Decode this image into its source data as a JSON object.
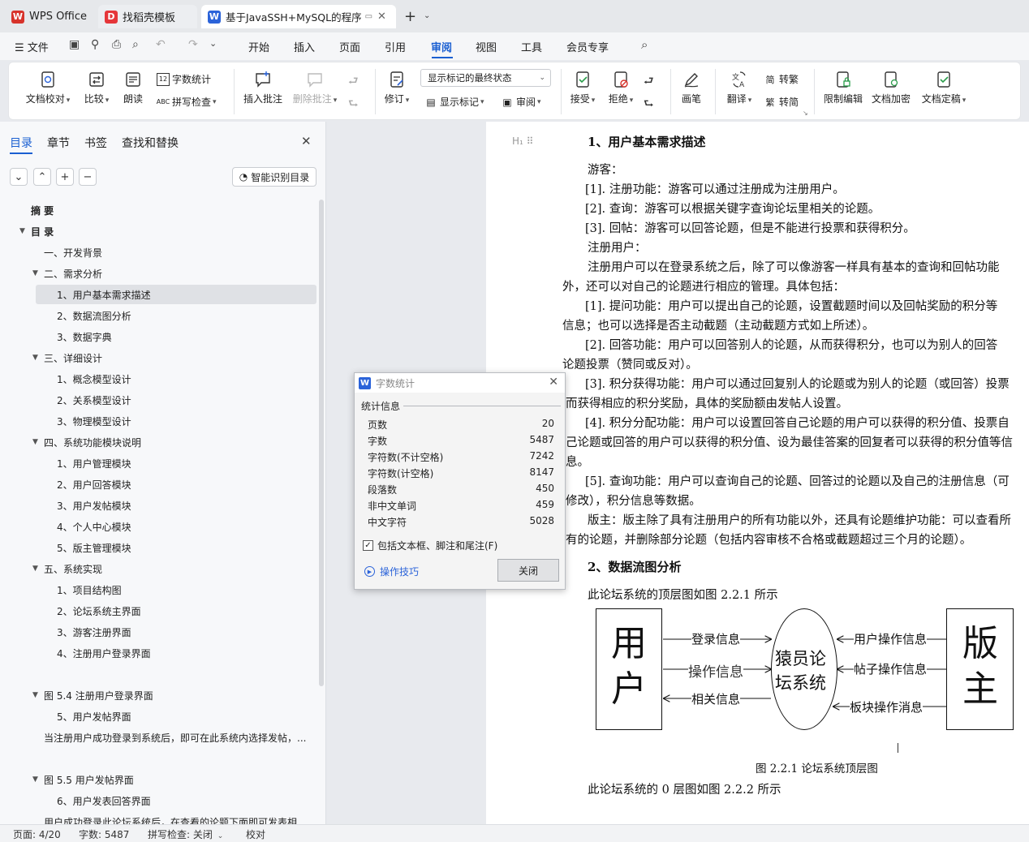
{
  "tabs": [
    {
      "label": "WPS Office",
      "logo": "W",
      "color": "#d7332b"
    },
    {
      "label": "找稻壳模板",
      "logo": "D",
      "color": "#e5363a"
    },
    {
      "label": "基于JavaSSH+MySQL的程序",
      "logo": "W",
      "color": "#2b63d9"
    }
  ],
  "menu": {
    "file": "文件",
    "items": [
      "开始",
      "插入",
      "页面",
      "引用",
      "审阅",
      "视图",
      "工具",
      "会员专享"
    ],
    "active": "审阅"
  },
  "ribbon": {
    "doc_check": "文档校对",
    "compare": "比较",
    "read_aloud": "朗读",
    "word_count": "字数统计",
    "spell_check": "拼写检查",
    "insert_comment": "插入批注",
    "delete_comment": "删除批注",
    "revise": "修订",
    "markup_state": "显示标记的最终状态",
    "show_markup": "显示标记",
    "review_pane": "审阅",
    "accept": "接受",
    "reject": "拒绝",
    "pen": "画笔",
    "translate": "翻译",
    "to_traditional": "转繁",
    "to_simplified": "转简",
    "restrict_edit": "限制编辑",
    "encrypt": "文档加密",
    "finalize": "文档定稿"
  },
  "left_panel": {
    "tabs": [
      "目录",
      "章节",
      "书签",
      "查找和替换"
    ],
    "smart_btn": "智能识别目录",
    "toc": [
      {
        "label": "摘  要",
        "level": 0,
        "arrow": false
      },
      {
        "label": "目  录",
        "level": 0,
        "arrow": true
      },
      {
        "label": "一、开发背景",
        "level": 1,
        "arrow": false
      },
      {
        "label": "二、需求分析",
        "level": 1,
        "arrow": true
      },
      {
        "label": "1、用户基本需求描述",
        "level": 2,
        "arrow": false,
        "selected": true
      },
      {
        "label": "2、数据流图分析",
        "level": 2,
        "arrow": false
      },
      {
        "label": "3、数据字典",
        "level": 2,
        "arrow": false
      },
      {
        "label": "三、详细设计",
        "level": 1,
        "arrow": true
      },
      {
        "label": "1、概念模型设计",
        "level": 2,
        "arrow": false
      },
      {
        "label": "2、关系模型设计",
        "level": 2,
        "arrow": false
      },
      {
        "label": "3、物理模型设计",
        "level": 2,
        "arrow": false
      },
      {
        "label": "四、系统功能模块说明",
        "level": 1,
        "arrow": true
      },
      {
        "label": "1、用户管理模块",
        "level": 2,
        "arrow": false
      },
      {
        "label": "2、用户回答模块",
        "level": 2,
        "arrow": false
      },
      {
        "label": "3、用户发帖模块",
        "level": 2,
        "arrow": false
      },
      {
        "label": "4、个人中心模块",
        "level": 2,
        "arrow": false
      },
      {
        "label": "5、版主管理模块",
        "level": 2,
        "arrow": false
      },
      {
        "label": "五、系统实现",
        "level": 1,
        "arrow": true
      },
      {
        "label": "1、项目结构图",
        "level": 2,
        "arrow": false
      },
      {
        "label": "2、论坛系统主界面",
        "level": 2,
        "arrow": false
      },
      {
        "label": "3、游客注册界面",
        "level": 2,
        "arrow": false
      },
      {
        "label": "4、注册用户登录界面",
        "level": 2,
        "arrow": false
      },
      {
        "label": "",
        "level": 2,
        "arrow": false
      },
      {
        "label": "图 5.4  注册用户登录界面",
        "level": 1,
        "arrow": true
      },
      {
        "label": "5、用户发帖界面",
        "level": 2,
        "arrow": false
      },
      {
        "label": "当注册用户成功登录到系统后，即可在此系统内选择发帖，...",
        "level": 1,
        "arrow": false
      },
      {
        "label": "",
        "level": 2,
        "arrow": false
      },
      {
        "label": "图 5.5  用户发帖界面",
        "level": 1,
        "arrow": true
      },
      {
        "label": "6、用户发表回答界面",
        "level": 2,
        "arrow": false
      },
      {
        "label": "用户成功登录此论坛系统后，在查看的论题下面即可发表相...",
        "level": 1,
        "arrow": false
      }
    ]
  },
  "dialog": {
    "title": "字数统计",
    "section": "统计信息",
    "stats": [
      {
        "label": "页数",
        "value": "20"
      },
      {
        "label": "字数",
        "value": "5487"
      },
      {
        "label": "字符数(不计空格)",
        "value": "7242"
      },
      {
        "label": "字符数(计空格)",
        "value": "8147"
      },
      {
        "label": "段落数",
        "value": "450"
      },
      {
        "label": "非中文单词",
        "value": "459"
      },
      {
        "label": "中文字符",
        "value": "5028"
      }
    ],
    "checkbox_label": "包括文本框、脚注和尾注(F)",
    "tips": "操作技巧",
    "close_btn": "关闭"
  },
  "document": {
    "heading1": "1、用户基本需求描述",
    "lines": [
      "游客：",
      "[1]. 注册功能：游客可以通过注册成为注册用户。",
      "[2]. 查询：游客可以根据关键字查询论坛里相关的论题。",
      "[3]. 回帖：游客可以回答论题，但是不能进行投票和获得积分。",
      "注册用户：",
      "注册用户可以在登录系统之后，除了可以像游客一样具有基本的查询和回帖功能",
      "外，还可以对自己的论题进行相应的管理。具体包括：",
      "[1]. 提问功能：用户可以提出自己的论题，设置截题时间以及回帖奖励的积分等",
      "信息；也可以选择是否主动截题（主动截题方式如上所述）。",
      "[2]. 回答功能：用户可以回答别人的论题，从而获得积分，也可以为别人的回答",
      "论题投票（赞同或反对）。",
      "[3]. 积分获得功能：用户可以通过回复别人的论题或为别人的论题（或回答）投票",
      "而获得相应的积分奖励，具体的奖励额由发帖人设置。",
      "[4]. 积分分配功能：用户可以设置回答自己论题的用户可以获得的积分值、投票自",
      "己论题或回答的用户可以获得的积分值、设为最佳答案的回复者可以获得的积分值等信",
      "息。",
      "[5]. 查询功能：用户可以查询自己的论题、回答过的论题以及自己的注册信息（可",
      "修改），积分信息等数据。",
      "版主：版主除了具有注册用户的所有功能以外，还具有论题维护功能：可以查看所",
      "有的论题，并删除部分论题（包括内容审核不合格或截题超过三个月的论题）。"
    ],
    "heading2": "2、数据流图分析",
    "para_top": "此论坛系统的顶层图如图 2.2.1 所示",
    "caption": "图 2.2.1 论坛系统顶层图",
    "para_zero": "此论坛系统的 0 层图如图 2.2.2 所示",
    "diagram": {
      "left_box": "用户",
      "right_box": "版主",
      "center": [
        "猿员论",
        "坛系统"
      ],
      "left_flows": [
        "登录信息",
        "操作信息",
        "相关信息"
      ],
      "right_flows": [
        "用户操作信息",
        "帖子操作信息",
        "板块操作消息"
      ]
    }
  },
  "status": {
    "page": "页面: 4/20",
    "words": "字数: 5487",
    "spell": "拼写检查: 关闭",
    "proof": "校对"
  }
}
